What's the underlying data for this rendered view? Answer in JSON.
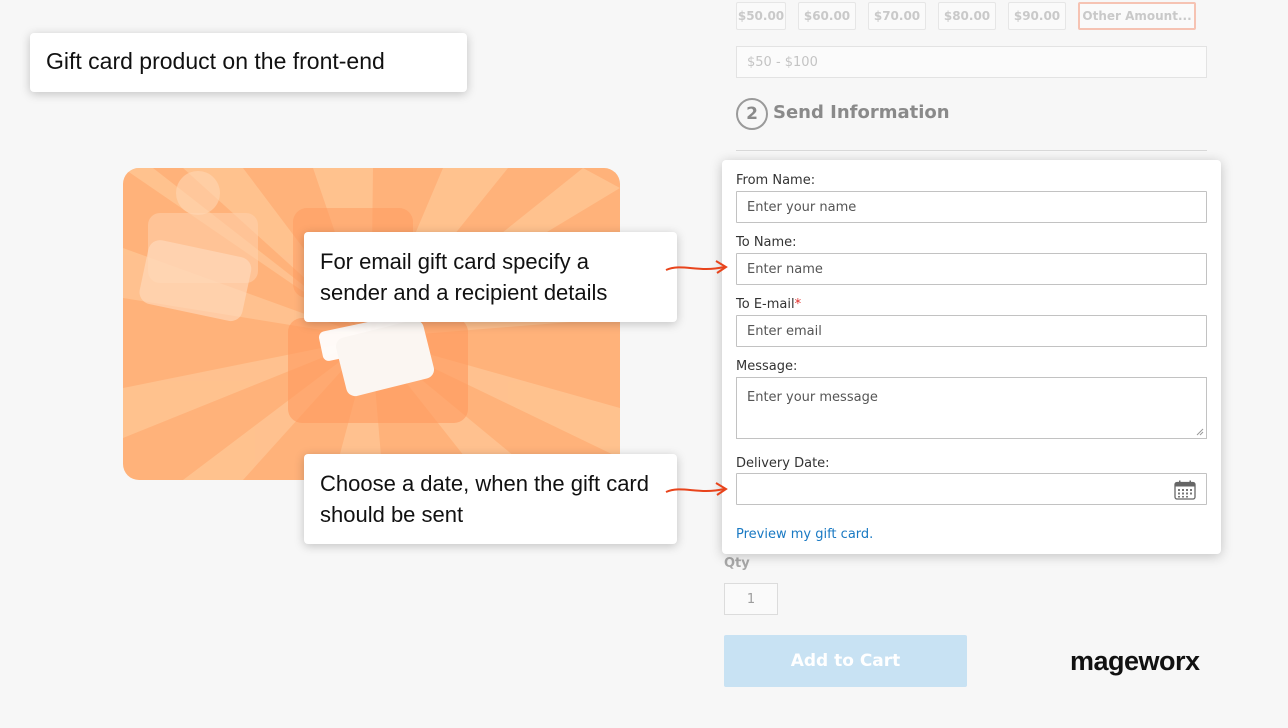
{
  "title": "Gift card product on the front-end",
  "amounts": [
    "$50.00",
    "$60.00",
    "$70.00",
    "$80.00",
    "$90.00",
    "Other Amount..."
  ],
  "amount_range_placeholder": "$50 - $100",
  "step": {
    "number": "2",
    "title": "Send Information"
  },
  "form": {
    "from_name": {
      "label": "From Name:",
      "placeholder": "Enter your name"
    },
    "to_name": {
      "label": "To Name:",
      "placeholder": "Enter name"
    },
    "to_email": {
      "label": "To E-mail",
      "required_mark": "*",
      "placeholder": "Enter email"
    },
    "message": {
      "label": "Message:",
      "placeholder": "Enter your message"
    },
    "delivery_date": {
      "label": "Delivery Date:",
      "value": ""
    },
    "preview_link": "Preview my gift card."
  },
  "qty": {
    "label": "Qty",
    "value": "1"
  },
  "add_to_cart": "Add to Cart",
  "callouts": {
    "sender": "For email gift card specify a sender and a recipient details",
    "date": "Choose a date, when the gift card should be sent"
  },
  "logo": "mageworx",
  "colors": {
    "accent_link": "#1979c3",
    "arrow": "#e8441c",
    "card_orange": "#ffb27a",
    "button_disabled": "#c8e2f3"
  },
  "icons": {
    "date_picker": "calendar-icon"
  }
}
